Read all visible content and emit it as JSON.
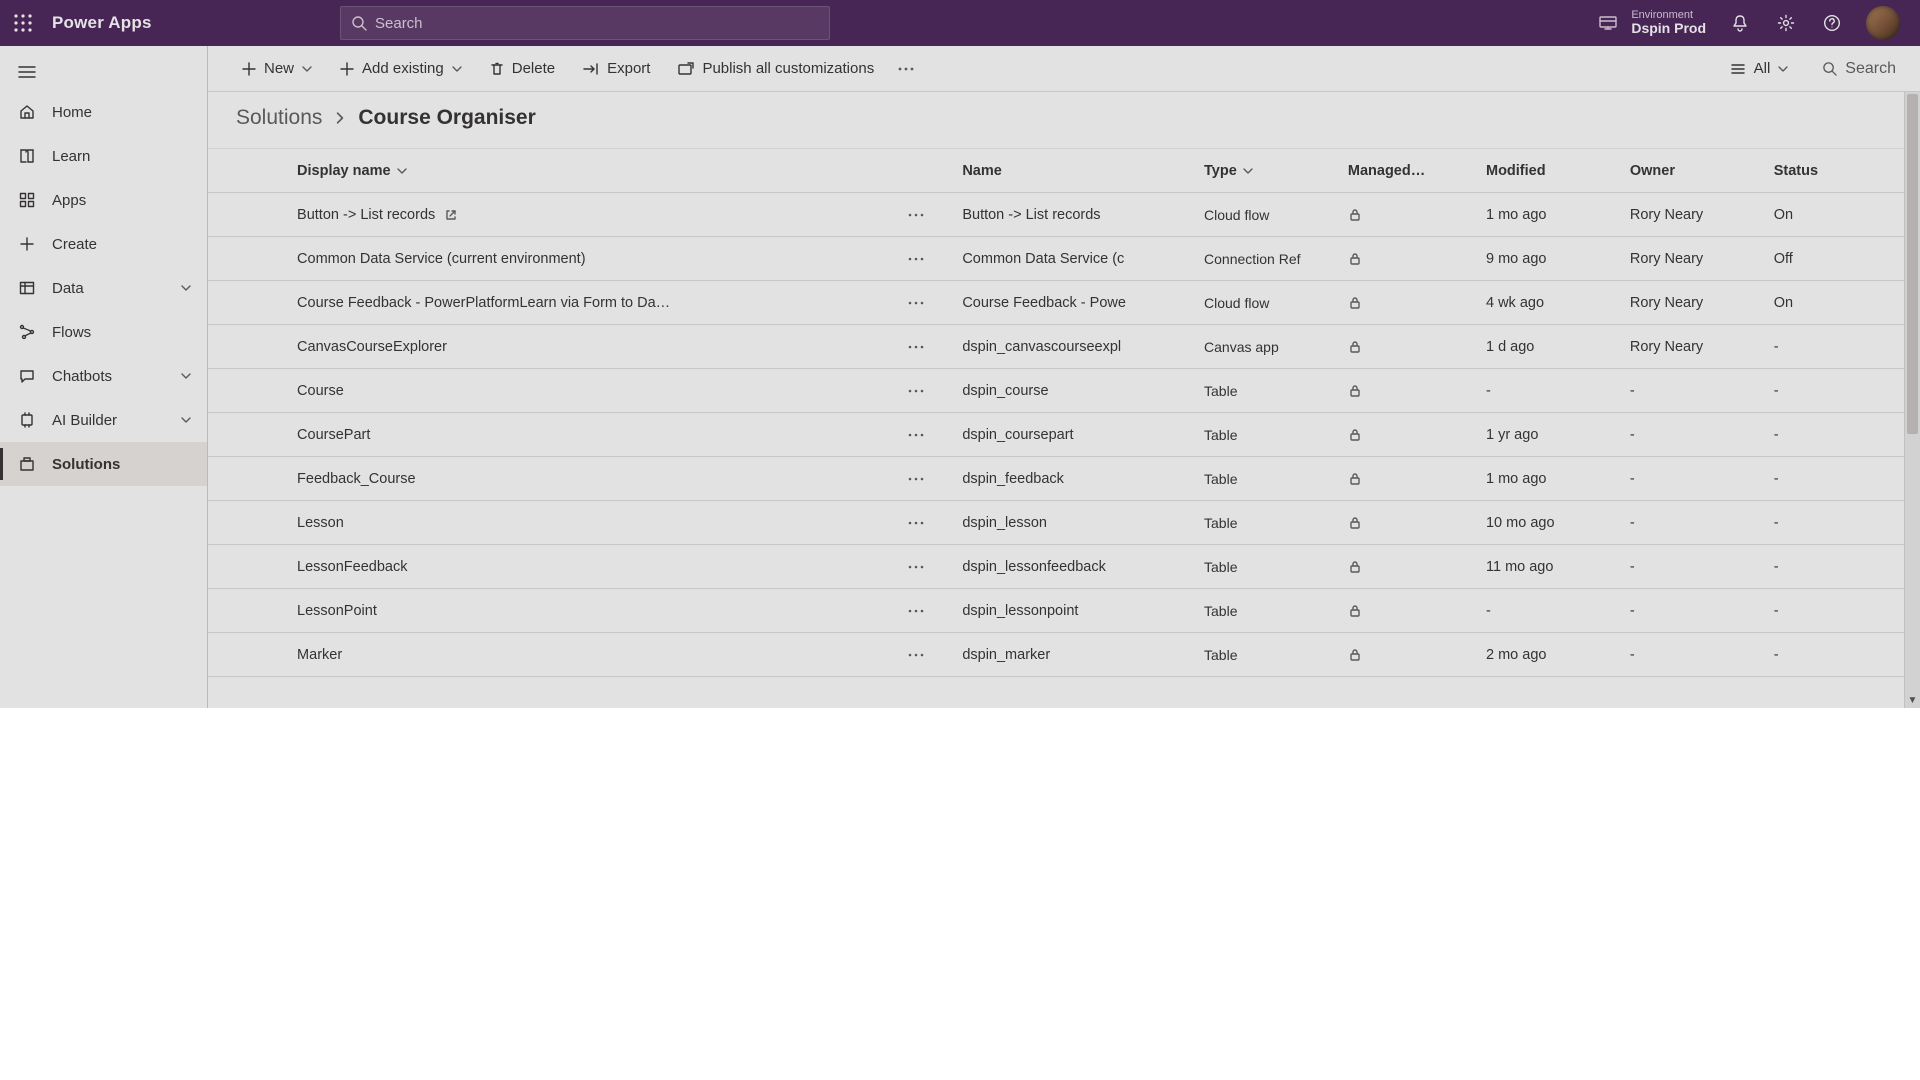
{
  "header": {
    "app_name": "Power Apps",
    "search_placeholder": "Search",
    "env_label": "Environment",
    "env_name": "Dspin Prod"
  },
  "nav": {
    "items": [
      {
        "label": "Home",
        "name": "nav-home",
        "icon": "home-icon"
      },
      {
        "label": "Learn",
        "name": "nav-learn",
        "icon": "book-icon"
      },
      {
        "label": "Apps",
        "name": "nav-apps",
        "icon": "grid-icon"
      },
      {
        "label": "Create",
        "name": "nav-create",
        "icon": "plus-icon"
      },
      {
        "label": "Data",
        "name": "nav-data",
        "icon": "table-icon",
        "expandable": true
      },
      {
        "label": "Flows",
        "name": "nav-flows",
        "icon": "flow-icon"
      },
      {
        "label": "Chatbots",
        "name": "nav-chatbots",
        "icon": "chat-icon",
        "expandable": true
      },
      {
        "label": "AI Builder",
        "name": "nav-aibuilder",
        "icon": "ai-icon",
        "expandable": true
      },
      {
        "label": "Solutions",
        "name": "nav-solutions",
        "icon": "solution-icon",
        "active": true
      }
    ]
  },
  "cmd": {
    "new": "New",
    "add_existing": "Add existing",
    "delete": "Delete",
    "export": "Export",
    "publish": "Publish all customizations",
    "filter_all": "All",
    "search": "Search"
  },
  "breadcrumb": {
    "parent": "Solutions",
    "current": "Course Organiser"
  },
  "columns": {
    "display": "Display name",
    "name": "Name",
    "type": "Type",
    "managed": "Managed…",
    "modified": "Modified",
    "owner": "Owner",
    "status": "Status"
  },
  "rows": [
    {
      "display": "Button -> List records",
      "open_ext": true,
      "name": "Button -> List records",
      "type": "Cloud flow",
      "modified": "1 mo ago",
      "owner": "Rory Neary",
      "status": "On"
    },
    {
      "display": "Common Data Service (current environment)",
      "name": "Common Data Service (c",
      "type": "Connection Ref",
      "modified": "9 mo ago",
      "owner": "Rory Neary",
      "status": "Off"
    },
    {
      "display": "Course Feedback - PowerPlatformLearn via Form to Da…",
      "name": "Course Feedback - Powe",
      "type": "Cloud flow",
      "modified": "4 wk ago",
      "owner": "Rory Neary",
      "status": "On"
    },
    {
      "display": "CanvasCourseExplorer",
      "name": "dspin_canvascourseexpl",
      "type": "Canvas app",
      "modified": "1 d ago",
      "owner": "Rory Neary",
      "status": "-"
    },
    {
      "display": "Course",
      "name": "dspin_course",
      "type": "Table",
      "modified": "-",
      "owner": "-",
      "status": "-"
    },
    {
      "display": "CoursePart",
      "name": "dspin_coursepart",
      "type": "Table",
      "modified": "1 yr ago",
      "owner": "-",
      "status": "-"
    },
    {
      "display": "Feedback_Course",
      "name": "dspin_feedback",
      "type": "Table",
      "modified": "1 mo ago",
      "owner": "-",
      "status": "-"
    },
    {
      "display": "Lesson",
      "name": "dspin_lesson",
      "type": "Table",
      "modified": "10 mo ago",
      "owner": "-",
      "status": "-"
    },
    {
      "display": "LessonFeedback",
      "name": "dspin_lessonfeedback",
      "type": "Table",
      "modified": "11 mo ago",
      "owner": "-",
      "status": "-"
    },
    {
      "display": "LessonPoint",
      "name": "dspin_lessonpoint",
      "type": "Table",
      "modified": "-",
      "owner": "-",
      "status": "-"
    },
    {
      "display": "Marker",
      "name": "dspin_marker",
      "type": "Table",
      "modified": "2 mo ago",
      "owner": "-",
      "status": "-"
    }
  ]
}
